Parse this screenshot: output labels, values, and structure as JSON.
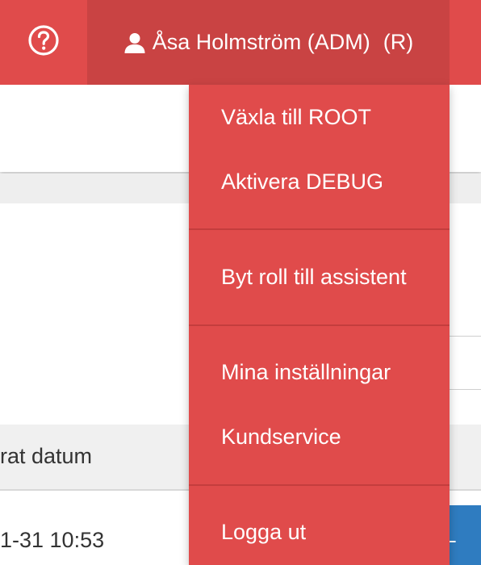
{
  "navbar": {
    "user_label": "Åsa Holmström (ADM)",
    "role_badge": "(R)",
    "help_icon": "help-circle-icon",
    "user_icon": "user-icon"
  },
  "dropdown": {
    "groups": [
      [
        "Växla till ROOT",
        "Aktivera DEBUG"
      ],
      [
        "Byt roll till assistent"
      ],
      [
        "Mina inställningar",
        "Kundservice"
      ],
      [
        "Logga ut"
      ]
    ]
  },
  "table": {
    "header_partial": "rat datum",
    "row_partial": "1-31 10:53",
    "row_button_partial": "L"
  },
  "colors": {
    "primary_red": "#e04b4b",
    "active_red": "#c94343",
    "divider_red": "#c43d3d",
    "button_blue": "#2f7cc0"
  }
}
